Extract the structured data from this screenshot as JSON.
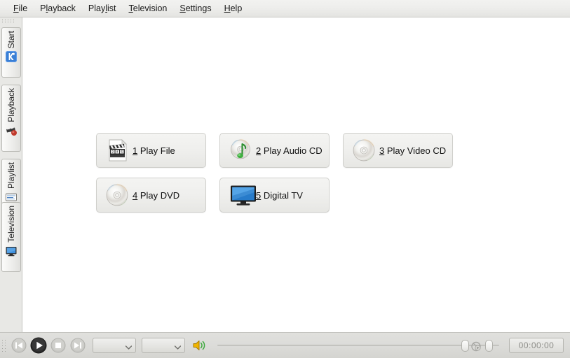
{
  "app": {
    "title": "Kaffeine",
    "content_background": "#ffffff",
    "chrome_background": "#e0e0dd"
  },
  "menubar": {
    "items": [
      {
        "label": "File",
        "mnemonic": "F",
        "name": "menu-file"
      },
      {
        "label": "Playback",
        "mnemonic": "P",
        "name": "menu-playback"
      },
      {
        "label": "Playlist",
        "mnemonic": "l",
        "name": "menu-playlist"
      },
      {
        "label": "Television",
        "mnemonic": "T",
        "name": "menu-television"
      },
      {
        "label": "Settings",
        "mnemonic": "S",
        "name": "menu-settings"
      },
      {
        "label": "Help",
        "mnemonic": "H",
        "name": "menu-help"
      }
    ]
  },
  "sidebar": {
    "tabs": [
      {
        "label": "Start",
        "icon": "kde-k-icon",
        "name": "sidebar-tab-start",
        "selected": true
      },
      {
        "label": "Playback",
        "icon": "clapperboard-icon",
        "name": "sidebar-tab-playback",
        "selected": false
      },
      {
        "label": "Playlist",
        "icon": "playlist-icon",
        "name": "sidebar-tab-playlist",
        "selected": false
      },
      {
        "label": "Television",
        "icon": "monitor-icon",
        "name": "sidebar-tab-television",
        "selected": false
      }
    ]
  },
  "main": {
    "buttons": [
      {
        "mnemonic": "1",
        "label": " Play File",
        "icon": "film-file-icon",
        "name": "play-file-button",
        "overlap": false
      },
      {
        "mnemonic": "2",
        "label": " Play Audio CD",
        "icon": "audio-cd-icon",
        "name": "play-audio-cd-button",
        "overlap": false
      },
      {
        "mnemonic": "3",
        "label": " Play Video CD",
        "icon": "compact-disc-icon",
        "name": "play-video-cd-button",
        "overlap": false
      },
      {
        "mnemonic": "4",
        "label": " Play DVD",
        "icon": "compact-disc-icon",
        "name": "play-dvd-button",
        "overlap": false
      },
      {
        "mnemonic": "5",
        "label": " Digital TV",
        "icon": "television-icon",
        "name": "digital-tv-button",
        "overlap": true
      }
    ]
  },
  "toolbar": {
    "transport": [
      {
        "icon": "skip-backward-icon",
        "name": "skip-backward-button",
        "enabled": false
      },
      {
        "icon": "play-icon",
        "name": "play-button",
        "enabled": true
      },
      {
        "icon": "stop-icon",
        "name": "stop-button",
        "enabled": false
      },
      {
        "icon": "skip-forward-icon",
        "name": "skip-forward-button",
        "enabled": false
      }
    ],
    "audio_track_combo": {
      "value": "",
      "name": "audio-track-combo"
    },
    "subtitle_combo": {
      "value": "",
      "name": "subtitle-combo"
    },
    "volume": {
      "icon": "volume-speaker-icon",
      "name": "volume-control"
    },
    "seek": {
      "name": "seek-slider"
    },
    "time_display": "00:00:00"
  }
}
